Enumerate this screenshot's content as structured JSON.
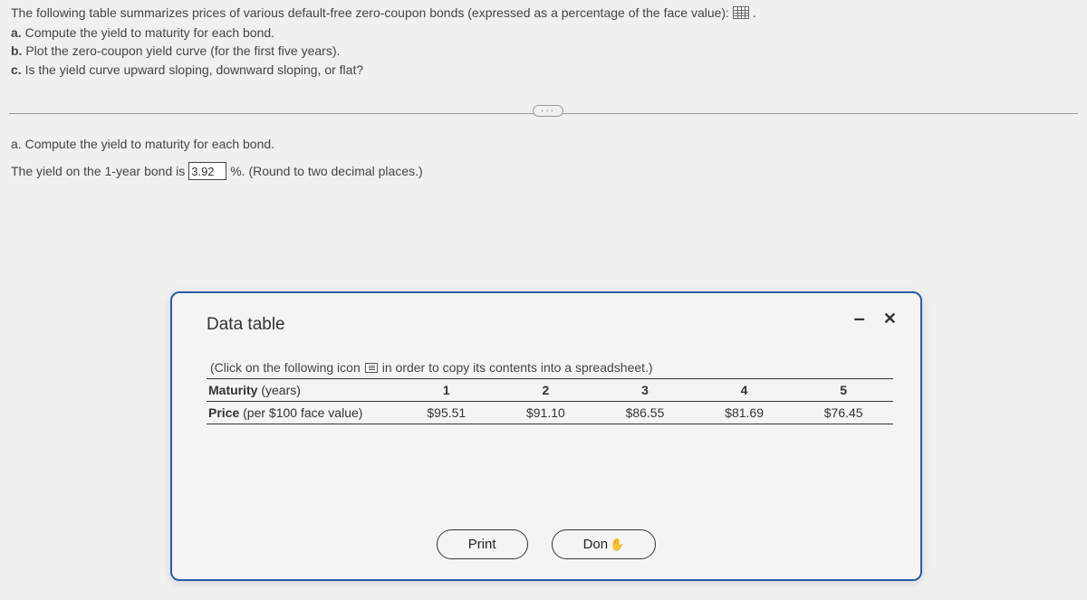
{
  "problem": {
    "intro": "The following table summarizes prices of various default-free zero-coupon bonds (expressed as a percentage of the face value):",
    "parts": {
      "a": "Compute the yield to maturity for each bond.",
      "b": "Plot the zero-coupon yield curve (for the first five years).",
      "c": "Is the yield curve upward sloping, downward sloping, or flat?"
    }
  },
  "answer": {
    "heading_prefix": "a.",
    "heading_text": "Compute the yield to maturity for each bond.",
    "line_pre": "The yield on the 1-year bond is",
    "input_value": "3.92",
    "line_post": "%.  (Round to two decimal places.)"
  },
  "ellipsis": "···",
  "modal": {
    "title": "Data table",
    "hint_pre": "(Click on the following icon",
    "hint_post": "in order to copy its contents into a spreadsheet.)",
    "row1_label_bold": "Maturity",
    "row1_label_paren": " (years)",
    "row2_label_bold": "Price",
    "row2_label_paren": " (per $100 face value)",
    "maturities": {
      "c1": "1",
      "c2": "2",
      "c3": "3",
      "c4": "4",
      "c5": "5"
    },
    "prices": {
      "c1": "$95.51",
      "c2": "$91.10",
      "c3": "$86.55",
      "c4": "$81.69",
      "c5": "$76.45"
    },
    "print_label": "Print",
    "done_label": "Don"
  },
  "chart_data": {
    "type": "table",
    "title": "Zero-coupon bond prices",
    "columns": [
      "Maturity (years)",
      "Price (per $100 face value)"
    ],
    "rows": [
      {
        "maturity": 1,
        "price": 95.51
      },
      {
        "maturity": 2,
        "price": 91.1
      },
      {
        "maturity": 3,
        "price": 86.55
      },
      {
        "maturity": 4,
        "price": 81.69
      },
      {
        "maturity": 5,
        "price": 76.45
      }
    ]
  }
}
